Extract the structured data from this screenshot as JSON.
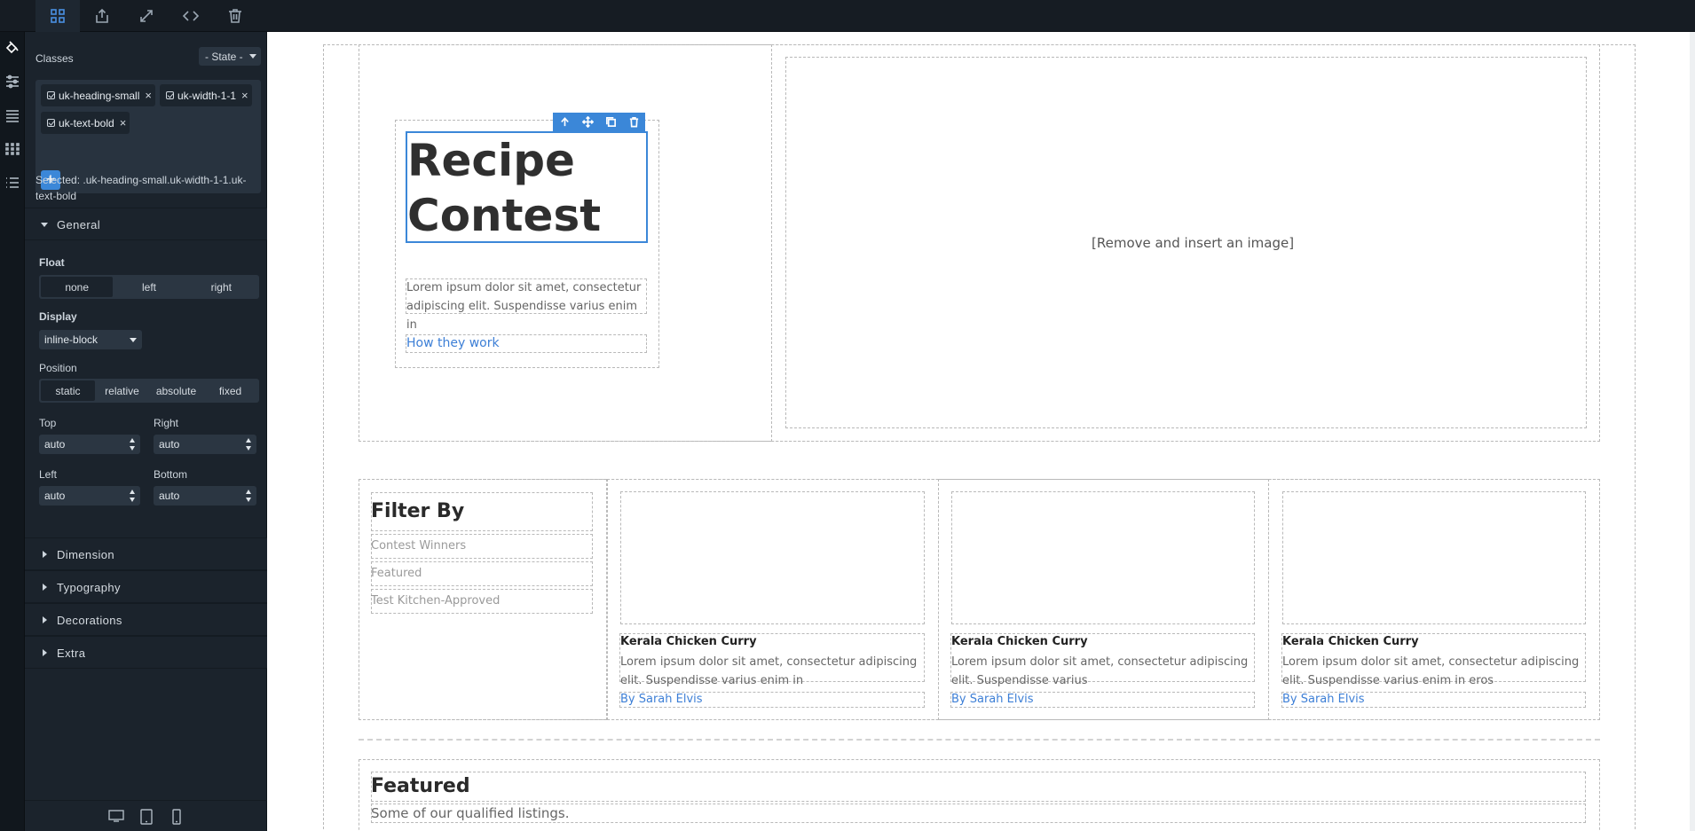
{
  "toolbar": {
    "buttons": [
      {
        "name": "open-blocks",
        "icon": "grid-icon",
        "active": true
      },
      {
        "name": "export",
        "icon": "export-icon",
        "active": false
      },
      {
        "name": "fullscreen",
        "icon": "expand-icon",
        "active": false
      },
      {
        "name": "view-code",
        "icon": "code-icon",
        "active": false
      },
      {
        "name": "clear-canvas",
        "icon": "trash-icon",
        "active": false
      }
    ]
  },
  "rail": {
    "items": [
      {
        "name": "style-manager",
        "icon": "paint-bucket-icon",
        "active": true
      },
      {
        "name": "settings",
        "icon": "sliders-icon",
        "active": false
      },
      {
        "name": "layers",
        "icon": "layers-icon",
        "active": false
      },
      {
        "name": "blocks",
        "icon": "blocks-grid-icon",
        "active": false
      },
      {
        "name": "list",
        "icon": "list-icon",
        "active": false
      }
    ]
  },
  "panel": {
    "classes_label": "Classes",
    "state_label": "- State -",
    "tags": [
      "uk-heading-small",
      "uk-width-1-1",
      "uk-text-bold"
    ],
    "add_label": "+",
    "selected_text": "Selected: .uk-heading-small.uk-width-1-1.uk-text-bold",
    "sector_general": "General",
    "float_label": "Float",
    "float_options": [
      "none",
      "left",
      "right"
    ],
    "float_selected": "none",
    "display_label": "Display",
    "display_value": "inline-block",
    "position_label": "Position",
    "position_options": [
      "static",
      "relative",
      "absolute",
      "fixed"
    ],
    "position_selected": "static",
    "top_label": "Top",
    "top_value": "auto",
    "right_label": "Right",
    "right_value": "auto",
    "left_label": "Left",
    "left_value": "auto",
    "bottom_label": "Bottom",
    "bottom_value": "auto",
    "sectors_collapsed": [
      "Dimension",
      "Typography",
      "Decorations",
      "Extra"
    ],
    "devices": [
      "desktop-icon",
      "tablet-icon",
      "mobile-icon"
    ]
  },
  "canvas": {
    "hero_title_line1": "Recipe",
    "hero_title_line2": "Contest",
    "hero_text": "Lorem ipsum dolor sit amet, consectetur adipiscing elit. Suspendisse varius enim in",
    "hero_link": "How they work",
    "image_placeholder": "[Remove and insert an image]",
    "filter_title": "Filter By",
    "filter_items": [
      "Contest Winners",
      "Featured",
      "Test Kitchen-Approved"
    ],
    "cards": [
      {
        "title": "Kerala Chicken Curry",
        "text": "Lorem ipsum dolor sit amet, consectetur adipiscing elit. Suspendisse varius enim in",
        "author": "By Sarah Elvis"
      },
      {
        "title": "Kerala Chicken Curry",
        "text": "Lorem ipsum dolor sit amet, consectetur adipiscing elit. Suspendisse varius",
        "author": "By Sarah Elvis"
      },
      {
        "title": "Kerala Chicken Curry",
        "text": "Lorem ipsum dolor sit amet, consectetur adipiscing elit. Suspendisse varius enim in eros",
        "author": "By Sarah Elvis"
      }
    ],
    "featured_title": "Featured",
    "featured_subtitle": "Some of our qualified listings."
  },
  "colors": {
    "accent": "#3b87d8",
    "panel_bg": "#1b232c",
    "canvas_bg": "#ffffff",
    "link": "#3d7fd6"
  }
}
